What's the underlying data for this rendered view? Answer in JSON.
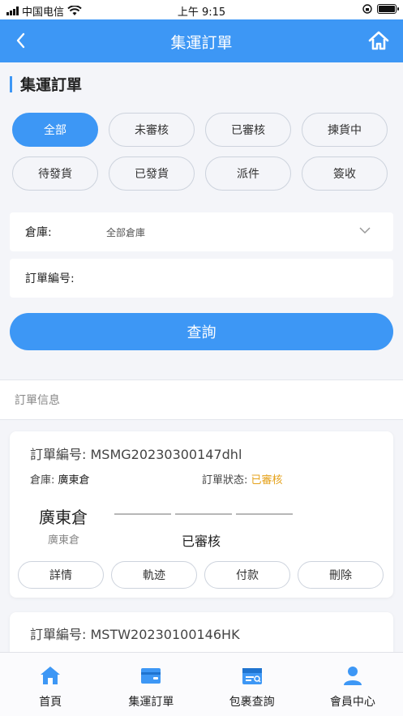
{
  "status_bar": {
    "carrier": "中国电信",
    "time": "上午 9:15"
  },
  "nav": {
    "title": "集運訂單"
  },
  "section": {
    "title": "集運訂單"
  },
  "filters": [
    {
      "label": "全部",
      "active": true
    },
    {
      "label": "未審核",
      "active": false
    },
    {
      "label": "已審核",
      "active": false
    },
    {
      "label": "揀貨中",
      "active": false
    },
    {
      "label": "待發貨",
      "active": false
    },
    {
      "label": "已發貨",
      "active": false
    },
    {
      "label": "派件",
      "active": false
    },
    {
      "label": "簽收",
      "active": false
    }
  ],
  "form": {
    "warehouse_label": "倉庫:",
    "warehouse_value": "全部倉庫",
    "order_no_label": "訂單編号:",
    "order_no_value": ""
  },
  "query_button": "查詢",
  "info_header": "訂單信息",
  "orders": [
    {
      "order_no_label": "訂單編号:",
      "order_no": "MSMG20230300147dhl",
      "warehouse_label": "倉庫:",
      "warehouse": "廣東倉",
      "status_label": "訂單狀态:",
      "status": "已審核",
      "big_warehouse": "廣東倉",
      "small_warehouse": "廣東倉",
      "progress_status": "已審核",
      "buttons": [
        "詳情",
        "軌迹",
        "付款",
        "刪除"
      ]
    },
    {
      "order_no_label": "訂單編号:",
      "order_no": "MSTW20230100146HK"
    }
  ],
  "tabs": [
    {
      "label": "首頁",
      "icon": "home-icon"
    },
    {
      "label": "集運訂單",
      "icon": "wallet-icon"
    },
    {
      "label": "包裹查詢",
      "icon": "package-search-icon"
    },
    {
      "label": "會員中心",
      "icon": "user-icon"
    }
  ],
  "colors": {
    "accent": "#3d97f5",
    "status_warn": "#e5a21b"
  }
}
